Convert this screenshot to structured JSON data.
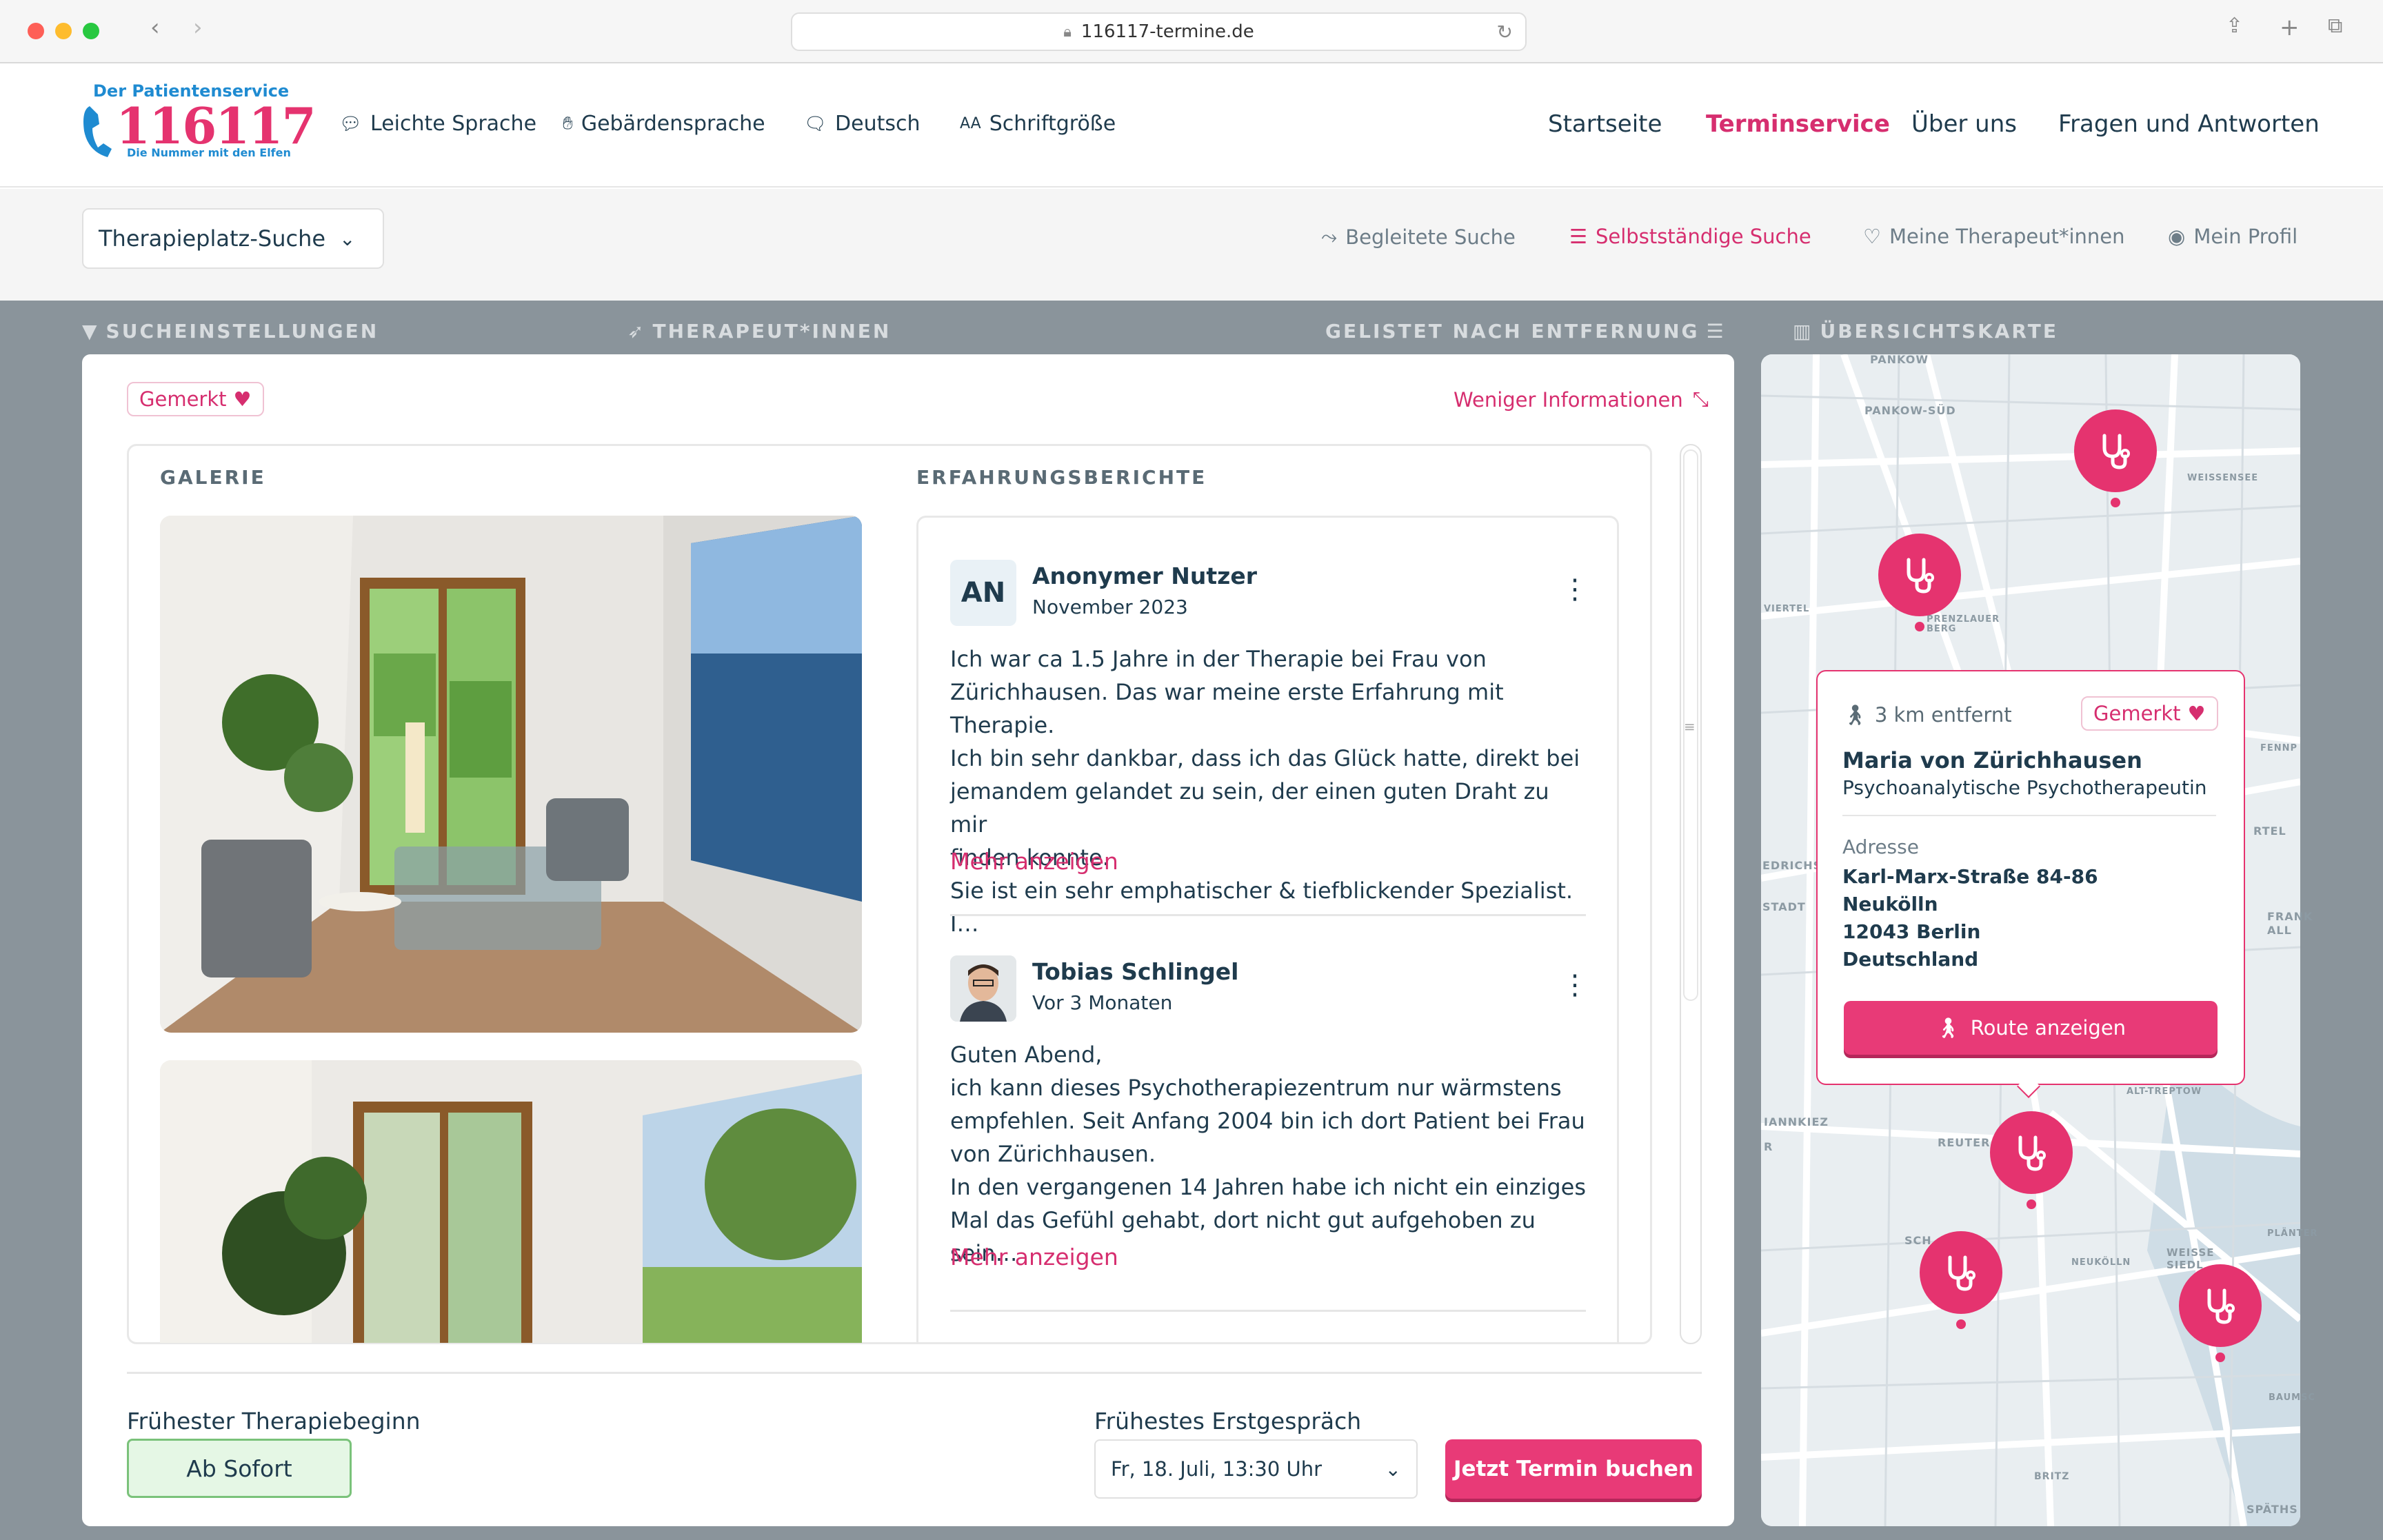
{
  "browser": {
    "url": "116117-termine.de"
  },
  "logo": {
    "top": "Der Patientenservice",
    "number": "116117",
    "sub": "Die Nummer mit den Elfen"
  },
  "utility": [
    {
      "label": "Leichte Sprache",
      "icon": "speech-bubble-icon"
    },
    {
      "label": "Gebärdensprache",
      "icon": "sign-language-icon"
    },
    {
      "label": "Deutsch",
      "icon": "language-icon"
    },
    {
      "label": "Schriftgröße",
      "icon": "font-size-icon",
      "prefix": "AA"
    }
  ],
  "nav": [
    {
      "label": "Startseite"
    },
    {
      "label": "Terminservice",
      "active": true
    },
    {
      "label": "Über uns"
    },
    {
      "label": "Fragen und Antworten"
    }
  ],
  "search_select": "Therapieplatz-Suche",
  "subnav": [
    {
      "label": "Begleitete Suche"
    },
    {
      "label": "Selbstständige Suche",
      "active": true
    },
    {
      "label": "Meine Therapeut*innen"
    },
    {
      "label": "Mein Profil"
    }
  ],
  "sections": {
    "settings": "SUCHEINSTELLUNGEN",
    "therapists": "THERAPEUT*INNEN",
    "listed": "GELISTET NACH ENTFERNUNG",
    "map": "ÜBERSICHTSKARTE"
  },
  "card": {
    "saved": "Gemerkt",
    "less_info": "Weniger Informationen",
    "gallery_label": "GALERIE",
    "reviews_label": "ERFAHRUNGSBERICHTE",
    "reviews": [
      {
        "initials": "AN",
        "name": "Anonymer Nutzer",
        "date": "November 2023",
        "lines": [
          "Ich war ca 1.5 Jahre in der Therapie bei Frau von",
          "Zürichhausen. Das war meine erste Erfahrung mit Therapie.",
          "Ich bin sehr dankbar, dass ich das Glück hatte, direkt bei",
          "jemandem gelandet zu sein, der einen guten Draht zu mir",
          "finden konnte.",
          "Sie ist ein sehr emphatischer & tiefblickender Spezialist. I…"
        ],
        "more": "Mehr anzeigen"
      },
      {
        "name": "Tobias Schlingel",
        "date": "Vor 3 Monaten",
        "lines": [
          "Guten Abend,",
          "ich kann dieses Psychotherapiezentrum nur wärmstens",
          "empfehlen. Seit Anfang 2004 bin ich dort Patient bei Frau",
          "von Zürichhausen.",
          "In den vergangenen 14 Jahren habe ich nicht ein einziges",
          "Mal das Gefühl gehabt, dort nicht gut aufgehoben zu sein…"
        ],
        "more": "Mehr anzeigen"
      }
    ],
    "earliest_start_label": "Frühester Therapiebeginn",
    "earliest_start_value": "Ab Sofort",
    "first_talk_label": "Frühestes Erstgespräch",
    "first_talk_value": "Fr, 18. Juli, 13:30 Uhr",
    "book": "Jetzt Termin buchen"
  },
  "map": {
    "districts": [
      "PANKOW",
      "PANKOW-SÜD",
      "WEISSENSEE",
      "PRENZLAUER BERG",
      "VIERTEL",
      "FENNP",
      "RTEL",
      "EDRICHS",
      "STADT",
      "FRANK ALL",
      "ALT-TREPTOW",
      "IANNKIEZ",
      "R",
      "REUTER",
      "SCH",
      "NEUKÖLLN",
      "PLÄNTER",
      "WEISSE SIEDL",
      "BAUMSC",
      "BRITZ",
      "SPÄTHS"
    ],
    "popup": {
      "distance": "3 km entfernt",
      "saved": "Gemerkt",
      "name": "Maria von Zürichhausen",
      "title": "Psychoanalytische Psychotherapeutin",
      "address_label": "Adresse",
      "address": [
        "Karl-Marx-Straße 84-86",
        "Neukölln",
        "12043 Berlin",
        "Deutschland"
      ],
      "route": "Route anzeigen"
    }
  },
  "colors": {
    "accent": "#e5336f",
    "text": "#1f3b4d",
    "green_bg": "#e5f7e5"
  }
}
